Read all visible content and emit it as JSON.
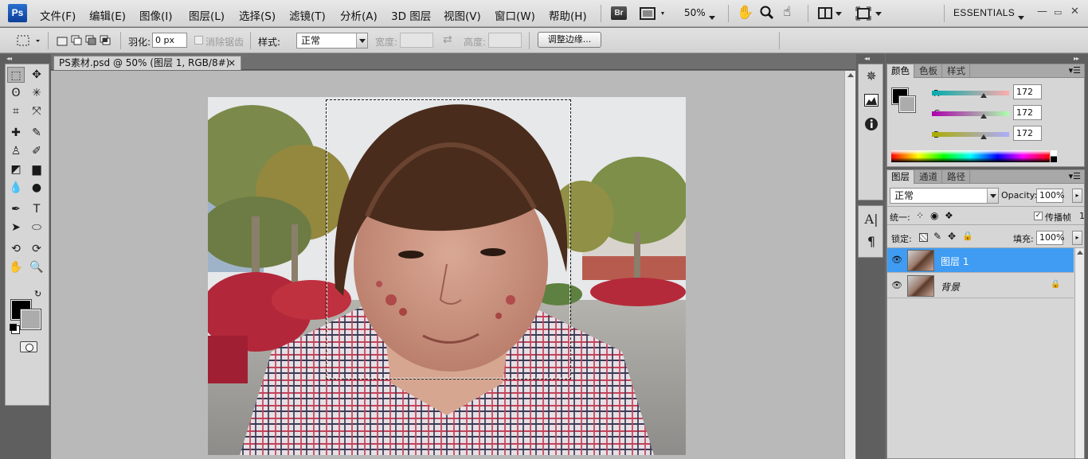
{
  "app": {
    "logo": "Ps"
  },
  "menu": {
    "items": [
      "文件(F)",
      "编辑(E)",
      "图像(I)",
      "图层(L)",
      "选择(S)",
      "滤镜(T)",
      "分析(A)",
      "3D 图层",
      "视图(V)",
      "窗口(W)",
      "帮助(H)"
    ],
    "bridge_label": "Br",
    "zoom": "50%",
    "workspace": "ESSENTIALS",
    "window_controls": [
      "—",
      "▭",
      "✕"
    ]
  },
  "options": {
    "feather_label": "羽化:",
    "feather_value": "0 px",
    "antialias_label": "消除锯齿",
    "style_label": "样式:",
    "style_value": "正常",
    "width_label": "宽度:",
    "height_label": "高度:",
    "refine_edge_button": "调整边缘..."
  },
  "document": {
    "tab_title": "PS素材.psd @ 50% (图层 1, RGB/8#)",
    "close": "×"
  },
  "tools": [
    {
      "name": "marquee-tool-icon",
      "glyph": "⬚"
    },
    {
      "name": "move-tool-icon",
      "glyph": "✥"
    },
    {
      "name": "lasso-tool-icon",
      "glyph": "ʘ"
    },
    {
      "name": "magic-wand-tool-icon",
      "glyph": "✳"
    },
    {
      "name": "crop-tool-icon",
      "glyph": "⌗"
    },
    {
      "name": "eyedropper-tool-icon",
      "glyph": "⤧"
    },
    {
      "name": "healing-brush-tool-icon",
      "glyph": "✚"
    },
    {
      "name": "brush-tool-icon",
      "glyph": "✎"
    },
    {
      "name": "clone-stamp-tool-icon",
      "glyph": "♙"
    },
    {
      "name": "history-brush-tool-icon",
      "glyph": "✐"
    },
    {
      "name": "eraser-tool-icon",
      "glyph": "◩"
    },
    {
      "name": "gradient-tool-icon",
      "glyph": "▆"
    },
    {
      "name": "blur-tool-icon",
      "glyph": "💧"
    },
    {
      "name": "dodge-tool-icon",
      "glyph": "●"
    },
    {
      "name": "pen-tool-icon",
      "glyph": "✒"
    },
    {
      "name": "type-tool-icon",
      "glyph": "T"
    },
    {
      "name": "path-selection-tool-icon",
      "glyph": "➤"
    },
    {
      "name": "ellipse-tool-icon",
      "glyph": "⬭"
    },
    {
      "name": "3d-rotate-tool-icon",
      "glyph": "⟲"
    },
    {
      "name": "3d-orbit-tool-icon",
      "glyph": "⟳"
    },
    {
      "name": "hand-tool-icon",
      "glyph": "✋"
    },
    {
      "name": "zoom-tool-icon",
      "glyph": "🔍"
    }
  ],
  "color_panel": {
    "tabs": [
      "颜色",
      "色板",
      "样式"
    ],
    "channels": [
      {
        "label": "R",
        "value": "172",
        "level": 172
      },
      {
        "label": "G",
        "value": "172",
        "level": 172
      },
      {
        "label": "B",
        "value": "172",
        "level": 172
      }
    ]
  },
  "layers_panel": {
    "tabs": [
      "图层",
      "通道",
      "路径"
    ],
    "blend_mode": "正常",
    "opacity_label": "Opacity:",
    "opacity_value": "100%",
    "unify_label": "统一:",
    "propagate_label": "传播帧",
    "propagate_value": "1",
    "lock_label": "锁定:",
    "fill_label": "填充:",
    "fill_value": "100%",
    "layers": [
      {
        "name": "图层 1",
        "selected": true,
        "locked": false
      },
      {
        "name": "背景",
        "selected": false,
        "locked": true
      }
    ]
  }
}
